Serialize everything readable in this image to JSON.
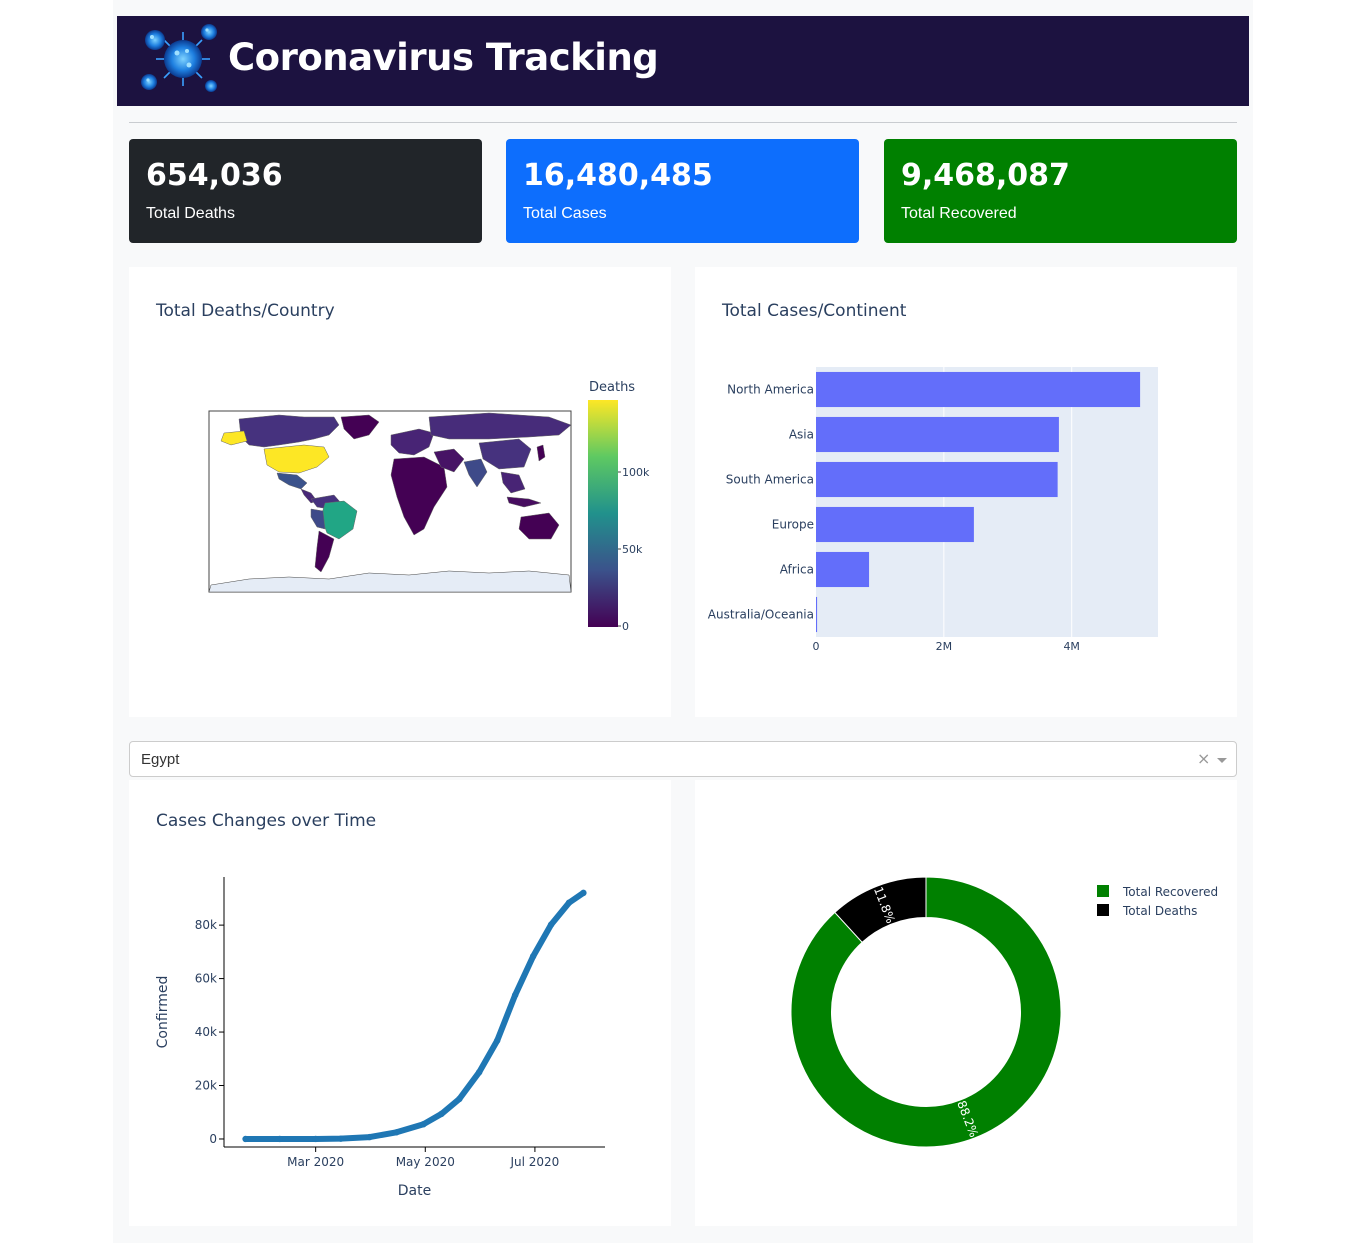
{
  "header": {
    "title": "Coronavirus Tracking",
    "logo": "virus-icon"
  },
  "stats": [
    {
      "value": "654,036",
      "label": "Total Deaths",
      "color": "#212529"
    },
    {
      "value": "16,480,485",
      "label": "Total Cases",
      "color": "#0d6efd"
    },
    {
      "value": "9,468,087",
      "label": "Total Recovered",
      "color": "#008000"
    }
  ],
  "map": {
    "title": "Total Deaths/Country",
    "colorbar": {
      "title": "Deaths",
      "ticks": [
        "100k",
        "50k",
        "0"
      ]
    },
    "colorscale": "Viridis",
    "highlights": [
      {
        "region": "USA",
        "level": "max"
      },
      {
        "region": "Brazil",
        "level": "high"
      }
    ]
  },
  "country_select": {
    "value": "Egypt"
  },
  "chart_data": [
    {
      "type": "bar",
      "orientation": "horizontal",
      "title": "Total Cases/Continent",
      "categories": [
        "North America",
        "Asia",
        "South America",
        "Europe",
        "Africa",
        "Australia/Oceania"
      ],
      "values": [
        5070000,
        3800000,
        3780000,
        2470000,
        830000,
        17000
      ],
      "xlim": [
        0,
        5350000
      ],
      "xticks": [
        {
          "value": 0,
          "label": "0"
        },
        {
          "value": 2000000,
          "label": "2M"
        },
        {
          "value": 4000000,
          "label": "4M"
        }
      ],
      "color": "#636efa",
      "background": "#e5ecf6"
    },
    {
      "type": "scatter",
      "title": "Cases Changes over Time",
      "xlabel": "Date",
      "ylabel": "Confirmed",
      "xticks": [
        "Mar 2020",
        "May 2020",
        "Jul 2020"
      ],
      "yticks": [
        "80k",
        "60k",
        "40k",
        "20k",
        "0"
      ],
      "ylim": [
        -3000,
        98000
      ],
      "color": "#1f77b4",
      "x": [
        "2020-01-22",
        "2020-02-10",
        "2020-03-01",
        "2020-03-15",
        "2020-03-31",
        "2020-04-15",
        "2020-04-30",
        "2020-05-10",
        "2020-05-20",
        "2020-05-31",
        "2020-06-10",
        "2020-06-20",
        "2020-06-30",
        "2020-07-10",
        "2020-07-20",
        "2020-07-28"
      ],
      "y": [
        0,
        0,
        2,
        126,
        710,
        2500,
        5537,
        9400,
        15000,
        24985,
        36800,
        53800,
        68300,
        80200,
        88400,
        92062
      ]
    },
    {
      "type": "pie",
      "hole": 0.7,
      "labels": [
        "Total Recovered",
        "Total Deaths"
      ],
      "values": [
        88.2,
        11.8
      ],
      "text": [
        "88.2%",
        "11.8%"
      ],
      "colors": [
        "#008000",
        "#000000"
      ]
    }
  ]
}
